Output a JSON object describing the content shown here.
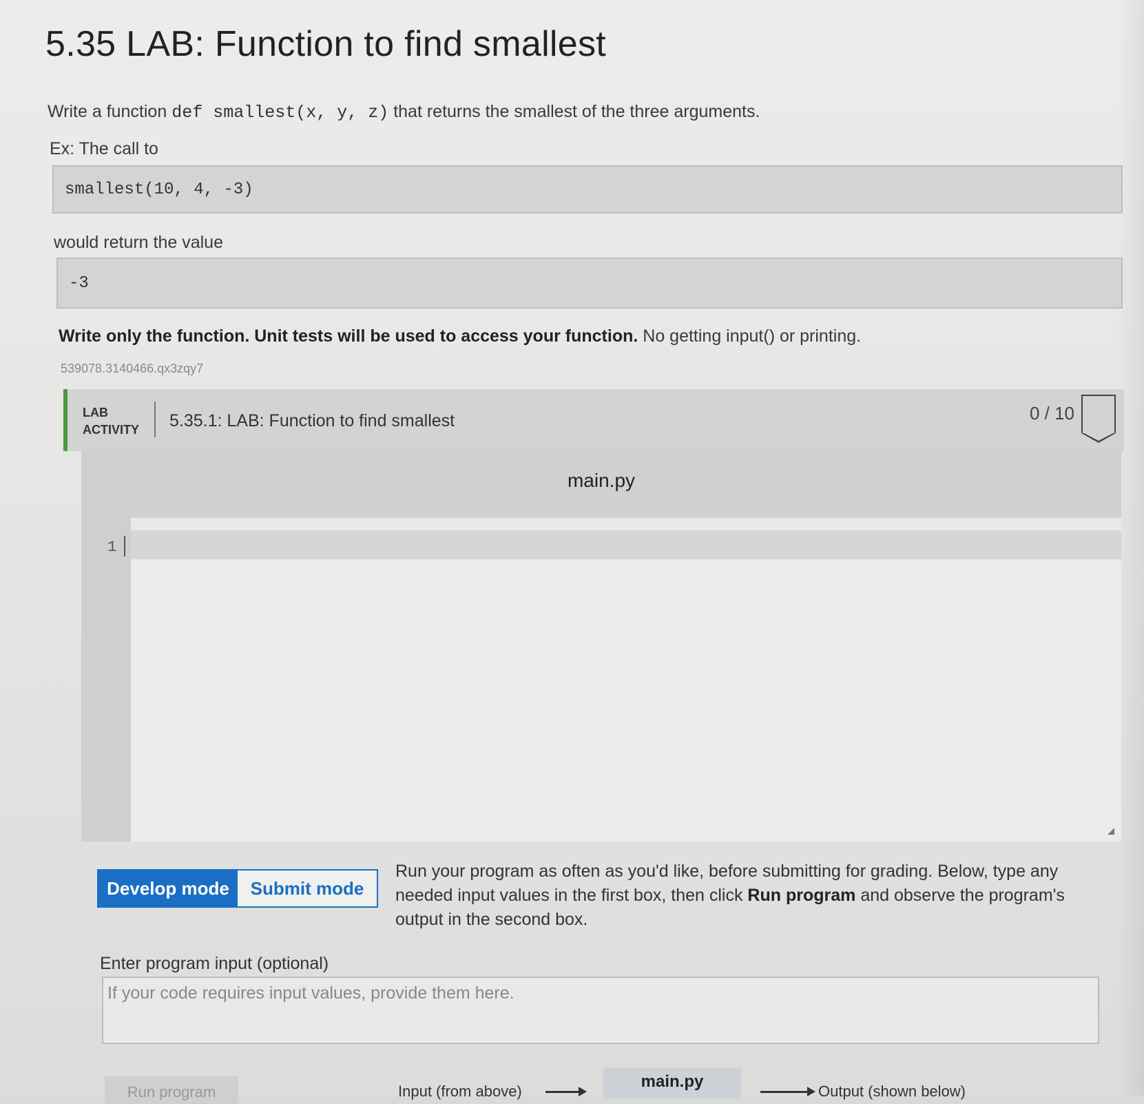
{
  "title": "5.35 LAB: Function to find smallest",
  "intro": {
    "pre": "Write a function ",
    "code": "def smallest(x, y, z)",
    "post": " that returns the smallest of the three arguments."
  },
  "example_label": "Ex: The call to",
  "example_call": "smallest(10, 4, -3)",
  "return_label": "would return the value",
  "return_value": "-3",
  "instruction": {
    "bold": "Write only the function. Unit tests will be used to access your function.",
    "normal": " No getting input() or printing."
  },
  "activity_id": "539078.3140466.qx3zqy7",
  "lab": {
    "tag_line1": "LAB",
    "tag_line2": "ACTIVITY",
    "name": "5.35.1: LAB: Function to find smallest",
    "score": "0 / 10"
  },
  "editor": {
    "filename": "main.py",
    "line_number": "1"
  },
  "modes": {
    "develop": "Develop mode",
    "submit": "Submit mode",
    "active": "develop"
  },
  "mode_description": {
    "part1": "Run your program as often as you'd like, before submitting for grading. Below, type any needed input values in the first box, then click ",
    "bold": "Run program",
    "part2": " and observe the program's output in the second box."
  },
  "input": {
    "label": "Enter program input (optional)",
    "placeholder": "If your code requires input values, provide them here."
  },
  "run_flow": {
    "run_button": "Run program",
    "input_label": "Input (from above)",
    "file": "main.py",
    "output_label": "Output (shown below)"
  },
  "colors": {
    "accent": "#1a6fc4",
    "lab_bar": "#4b9a3a"
  }
}
